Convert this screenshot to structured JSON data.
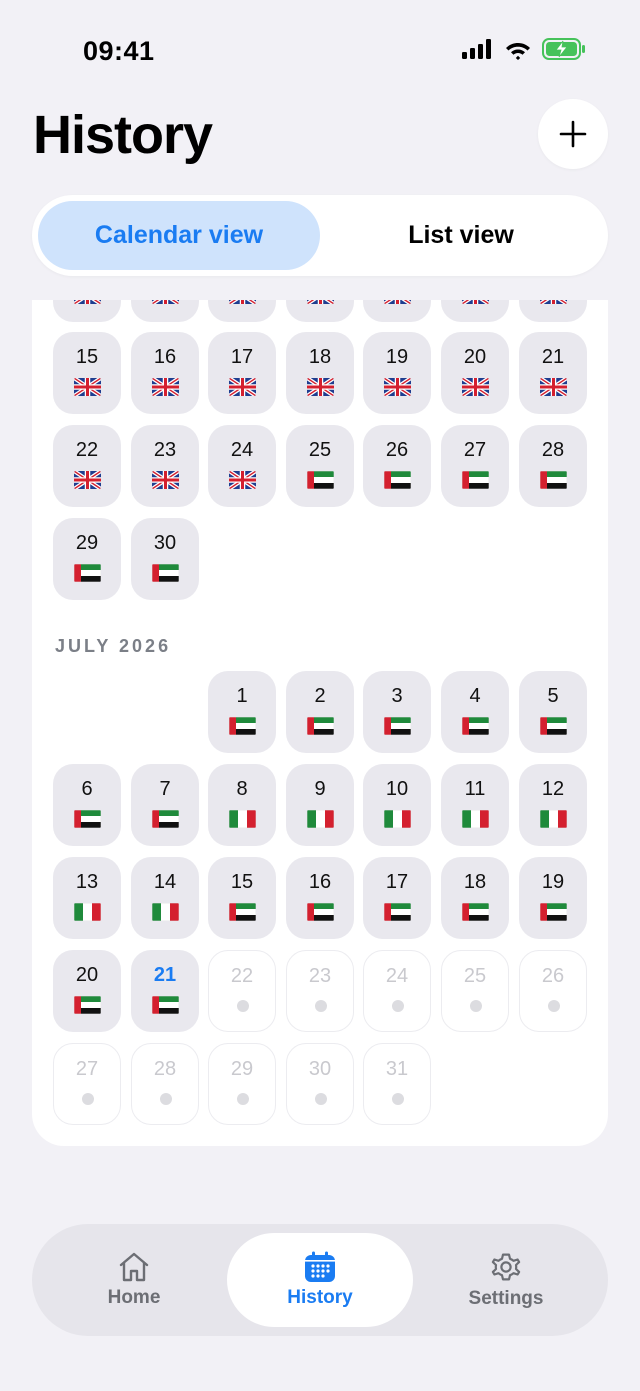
{
  "status_bar": {
    "time": "09:41"
  },
  "header": {
    "title": "History"
  },
  "segmented": {
    "calendar_label": "Calendar view",
    "list_label": "List view"
  },
  "june_partial_top": [
    {
      "flag": "uk"
    },
    {
      "flag": "uk"
    },
    {
      "flag": "uk"
    },
    {
      "flag": "uk"
    },
    {
      "flag": "uk"
    },
    {
      "flag": "uk"
    },
    {
      "flag": "uk"
    }
  ],
  "june_days": [
    {
      "day": "15",
      "flag": "uk"
    },
    {
      "day": "16",
      "flag": "uk"
    },
    {
      "day": "17",
      "flag": "uk"
    },
    {
      "day": "18",
      "flag": "uk"
    },
    {
      "day": "19",
      "flag": "uk"
    },
    {
      "day": "20",
      "flag": "uk"
    },
    {
      "day": "21",
      "flag": "uk"
    },
    {
      "day": "22",
      "flag": "uk"
    },
    {
      "day": "23",
      "flag": "uk"
    },
    {
      "day": "24",
      "flag": "uk"
    },
    {
      "day": "25",
      "flag": "uae"
    },
    {
      "day": "26",
      "flag": "uae"
    },
    {
      "day": "27",
      "flag": "uae"
    },
    {
      "day": "28",
      "flag": "uae"
    },
    {
      "day": "29",
      "flag": "uae"
    },
    {
      "day": "30",
      "flag": "uae"
    }
  ],
  "july": {
    "label": "JULY 2026",
    "days": [
      {
        "day": "1",
        "flag": "uae"
      },
      {
        "day": "2",
        "flag": "uae"
      },
      {
        "day": "3",
        "flag": "uae"
      },
      {
        "day": "4",
        "flag": "uae"
      },
      {
        "day": "5",
        "flag": "uae"
      },
      {
        "day": "6",
        "flag": "uae"
      },
      {
        "day": "7",
        "flag": "uae"
      },
      {
        "day": "8",
        "flag": "italy"
      },
      {
        "day": "9",
        "flag": "italy"
      },
      {
        "day": "10",
        "flag": "italy"
      },
      {
        "day": "11",
        "flag": "italy"
      },
      {
        "day": "12",
        "flag": "italy"
      },
      {
        "day": "13",
        "flag": "italy"
      },
      {
        "day": "14",
        "flag": "italy"
      },
      {
        "day": "15",
        "flag": "uae"
      },
      {
        "day": "16",
        "flag": "uae"
      },
      {
        "day": "17",
        "flag": "uae"
      },
      {
        "day": "18",
        "flag": "uae"
      },
      {
        "day": "19",
        "flag": "uae"
      },
      {
        "day": "20",
        "flag": "uae"
      },
      {
        "day": "21",
        "flag": "uae",
        "today": true
      },
      {
        "day": "22",
        "future": true
      },
      {
        "day": "23",
        "future": true
      },
      {
        "day": "24",
        "future": true
      },
      {
        "day": "25",
        "future": true
      },
      {
        "day": "26",
        "future": true
      },
      {
        "day": "27",
        "future": true
      },
      {
        "day": "28",
        "future": true
      },
      {
        "day": "29",
        "future": true
      },
      {
        "day": "30",
        "future": true
      },
      {
        "day": "31",
        "future": true
      }
    ]
  },
  "tab_bar": {
    "home_label": "Home",
    "history_label": "History",
    "settings_label": "Settings"
  },
  "colors": {
    "accent": "#1a7cf2",
    "selected_segment": "#cfe3fc",
    "background": "#f2f1f6"
  }
}
